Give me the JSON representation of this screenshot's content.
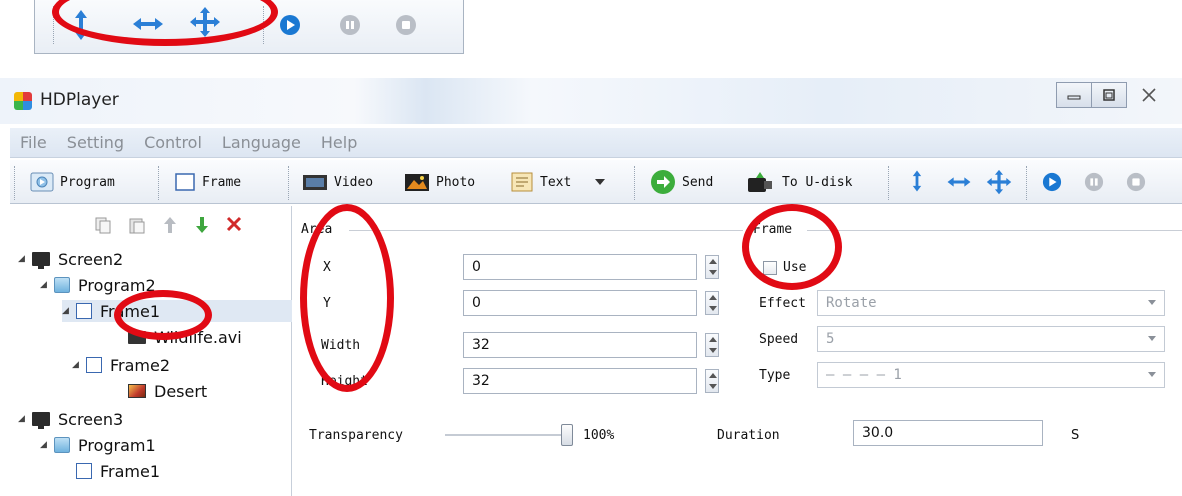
{
  "window": {
    "title": "HDPlayer"
  },
  "menu": [
    "File",
    "Setting",
    "Control",
    "Language",
    "Help"
  ],
  "toolbar": {
    "program": "Program",
    "frame": "Frame",
    "video": "Video",
    "photo": "Photo",
    "text": "Text",
    "send": "Send",
    "udisk": "To U-disk"
  },
  "tree": {
    "screen2": "Screen2",
    "program2": "Program2",
    "frame1": "Frame1",
    "wildlife": "Wildlife.avi",
    "frame2": "Frame2",
    "desert": "Desert",
    "screen3": "Screen3",
    "program1": "Program1",
    "frame1b": "Frame1"
  },
  "area": {
    "title": "Area",
    "x_label": "X",
    "x_value": "0",
    "y_label": "Y",
    "y_value": "0",
    "width_label": "Width",
    "width_value": "32",
    "height_label": "Height",
    "height_value": "32"
  },
  "frame_group": {
    "title": "Frame",
    "use_label": "Use",
    "effect_label": "Effect",
    "effect_value": "Rotate",
    "speed_label": "Speed",
    "speed_value": "5",
    "type_label": "Type",
    "type_value": "— — — — 1"
  },
  "transparency": {
    "label": "Transparency",
    "value": "100%"
  },
  "duration": {
    "label": "Duration",
    "value": "30.0",
    "unit": "S"
  },
  "colors": {
    "highlight": "#e10a14",
    "accent": "#2f8de0"
  }
}
